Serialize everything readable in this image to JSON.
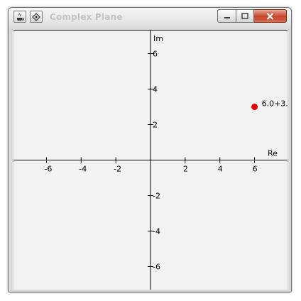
{
  "window": {
    "title": "Complex Plane",
    "icons": [
      "java-app-icon",
      "diamond-menu-icon"
    ],
    "controls": {
      "minimize": "minimize-icon",
      "maximize": "maximize-icon",
      "close": "close-icon"
    }
  },
  "chart_data": {
    "type": "scatter",
    "title": "",
    "xlabel": "Re",
    "ylabel": "Im",
    "xlim": [
      -7.9,
      7.9
    ],
    "ylim": [
      -7.3,
      7.3
    ],
    "x_ticks": [
      -6,
      -4,
      -2,
      2,
      4,
      6
    ],
    "y_ticks": [
      6,
      4,
      2,
      -2,
      -4,
      -6
    ],
    "grid": false,
    "points": [
      {
        "x": 6.0,
        "y": 3.0,
        "label": "6.0+3.",
        "color": "#e00000"
      }
    ]
  }
}
